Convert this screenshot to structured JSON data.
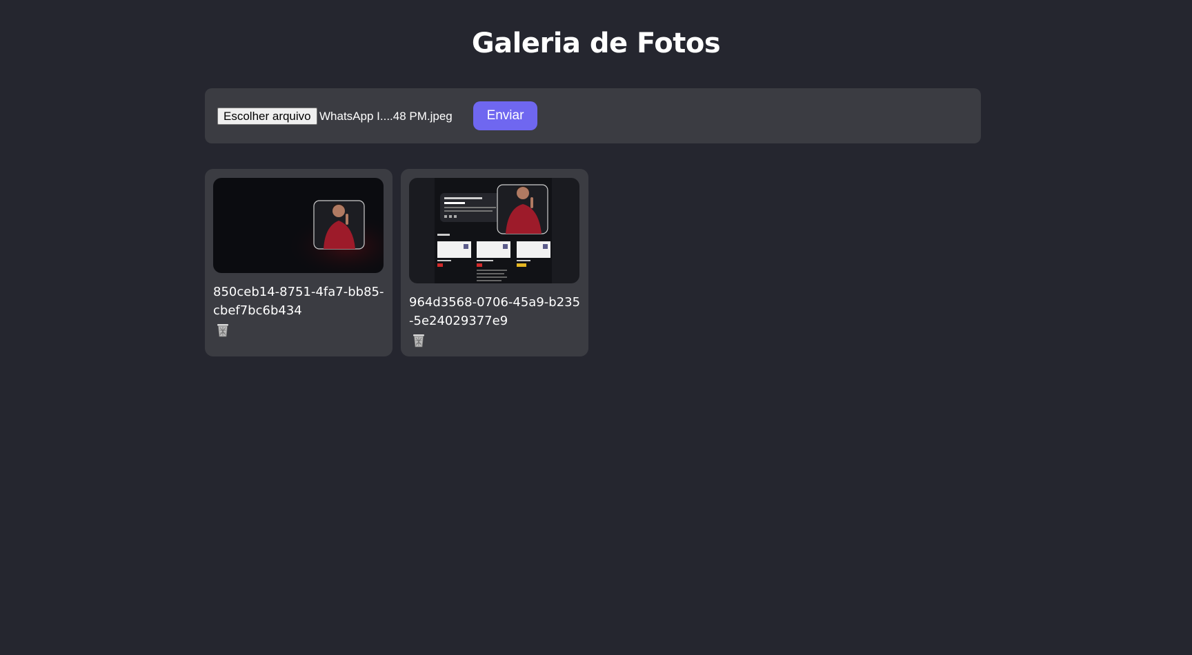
{
  "page": {
    "title": "Galeria de Fotos"
  },
  "upload": {
    "file_button_label": "Escolher arquivo",
    "selected_file": "WhatsApp I....48 PM.jpeg",
    "submit_label": "Enviar"
  },
  "photos": [
    {
      "id": "850ceb14-8751-4fa7-bb85-cbef7bc6b434",
      "delete_icon": "trash-icon"
    },
    {
      "id": "964d3568-0706-45a9-b235-5e24029377e9",
      "delete_icon": "trash-icon"
    }
  ],
  "colors": {
    "background": "#25262f",
    "panel": "#3b3c42",
    "accent": "#6f67f0",
    "text": "#ffffff"
  }
}
